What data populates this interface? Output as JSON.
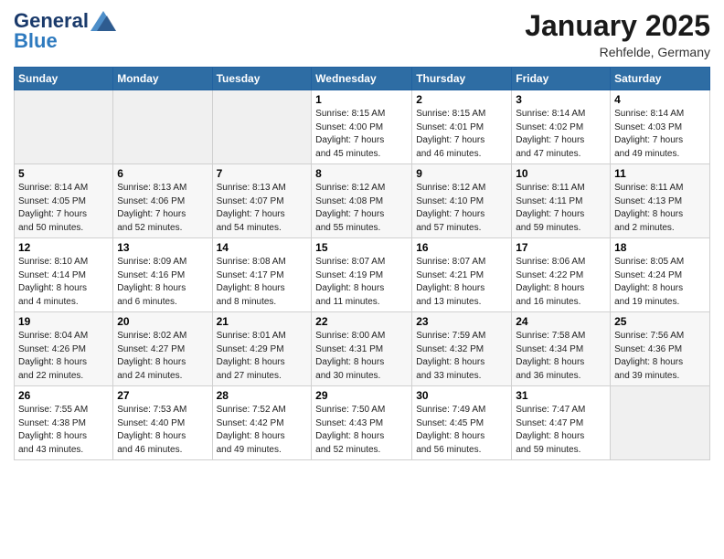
{
  "header": {
    "logo_general": "General",
    "logo_blue": "Blue",
    "title": "January 2025",
    "subtitle": "Rehfelde, Germany"
  },
  "calendar": {
    "days_of_week": [
      "Sunday",
      "Monday",
      "Tuesday",
      "Wednesday",
      "Thursday",
      "Friday",
      "Saturday"
    ],
    "weeks": [
      [
        {
          "day": "",
          "info": ""
        },
        {
          "day": "",
          "info": ""
        },
        {
          "day": "",
          "info": ""
        },
        {
          "day": "1",
          "info": "Sunrise: 8:15 AM\nSunset: 4:00 PM\nDaylight: 7 hours\nand 45 minutes."
        },
        {
          "day": "2",
          "info": "Sunrise: 8:15 AM\nSunset: 4:01 PM\nDaylight: 7 hours\nand 46 minutes."
        },
        {
          "day": "3",
          "info": "Sunrise: 8:14 AM\nSunset: 4:02 PM\nDaylight: 7 hours\nand 47 minutes."
        },
        {
          "day": "4",
          "info": "Sunrise: 8:14 AM\nSunset: 4:03 PM\nDaylight: 7 hours\nand 49 minutes."
        }
      ],
      [
        {
          "day": "5",
          "info": "Sunrise: 8:14 AM\nSunset: 4:05 PM\nDaylight: 7 hours\nand 50 minutes."
        },
        {
          "day": "6",
          "info": "Sunrise: 8:13 AM\nSunset: 4:06 PM\nDaylight: 7 hours\nand 52 minutes."
        },
        {
          "day": "7",
          "info": "Sunrise: 8:13 AM\nSunset: 4:07 PM\nDaylight: 7 hours\nand 54 minutes."
        },
        {
          "day": "8",
          "info": "Sunrise: 8:12 AM\nSunset: 4:08 PM\nDaylight: 7 hours\nand 55 minutes."
        },
        {
          "day": "9",
          "info": "Sunrise: 8:12 AM\nSunset: 4:10 PM\nDaylight: 7 hours\nand 57 minutes."
        },
        {
          "day": "10",
          "info": "Sunrise: 8:11 AM\nSunset: 4:11 PM\nDaylight: 7 hours\nand 59 minutes."
        },
        {
          "day": "11",
          "info": "Sunrise: 8:11 AM\nSunset: 4:13 PM\nDaylight: 8 hours\nand 2 minutes."
        }
      ],
      [
        {
          "day": "12",
          "info": "Sunrise: 8:10 AM\nSunset: 4:14 PM\nDaylight: 8 hours\nand 4 minutes."
        },
        {
          "day": "13",
          "info": "Sunrise: 8:09 AM\nSunset: 4:16 PM\nDaylight: 8 hours\nand 6 minutes."
        },
        {
          "day": "14",
          "info": "Sunrise: 8:08 AM\nSunset: 4:17 PM\nDaylight: 8 hours\nand 8 minutes."
        },
        {
          "day": "15",
          "info": "Sunrise: 8:07 AM\nSunset: 4:19 PM\nDaylight: 8 hours\nand 11 minutes."
        },
        {
          "day": "16",
          "info": "Sunrise: 8:07 AM\nSunset: 4:21 PM\nDaylight: 8 hours\nand 13 minutes."
        },
        {
          "day": "17",
          "info": "Sunrise: 8:06 AM\nSunset: 4:22 PM\nDaylight: 8 hours\nand 16 minutes."
        },
        {
          "day": "18",
          "info": "Sunrise: 8:05 AM\nSunset: 4:24 PM\nDaylight: 8 hours\nand 19 minutes."
        }
      ],
      [
        {
          "day": "19",
          "info": "Sunrise: 8:04 AM\nSunset: 4:26 PM\nDaylight: 8 hours\nand 22 minutes."
        },
        {
          "day": "20",
          "info": "Sunrise: 8:02 AM\nSunset: 4:27 PM\nDaylight: 8 hours\nand 24 minutes."
        },
        {
          "day": "21",
          "info": "Sunrise: 8:01 AM\nSunset: 4:29 PM\nDaylight: 8 hours\nand 27 minutes."
        },
        {
          "day": "22",
          "info": "Sunrise: 8:00 AM\nSunset: 4:31 PM\nDaylight: 8 hours\nand 30 minutes."
        },
        {
          "day": "23",
          "info": "Sunrise: 7:59 AM\nSunset: 4:32 PM\nDaylight: 8 hours\nand 33 minutes."
        },
        {
          "day": "24",
          "info": "Sunrise: 7:58 AM\nSunset: 4:34 PM\nDaylight: 8 hours\nand 36 minutes."
        },
        {
          "day": "25",
          "info": "Sunrise: 7:56 AM\nSunset: 4:36 PM\nDaylight: 8 hours\nand 39 minutes."
        }
      ],
      [
        {
          "day": "26",
          "info": "Sunrise: 7:55 AM\nSunset: 4:38 PM\nDaylight: 8 hours\nand 43 minutes."
        },
        {
          "day": "27",
          "info": "Sunrise: 7:53 AM\nSunset: 4:40 PM\nDaylight: 8 hours\nand 46 minutes."
        },
        {
          "day": "28",
          "info": "Sunrise: 7:52 AM\nSunset: 4:42 PM\nDaylight: 8 hours\nand 49 minutes."
        },
        {
          "day": "29",
          "info": "Sunrise: 7:50 AM\nSunset: 4:43 PM\nDaylight: 8 hours\nand 52 minutes."
        },
        {
          "day": "30",
          "info": "Sunrise: 7:49 AM\nSunset: 4:45 PM\nDaylight: 8 hours\nand 56 minutes."
        },
        {
          "day": "31",
          "info": "Sunrise: 7:47 AM\nSunset: 4:47 PM\nDaylight: 8 hours\nand 59 minutes."
        },
        {
          "day": "",
          "info": ""
        }
      ]
    ]
  }
}
